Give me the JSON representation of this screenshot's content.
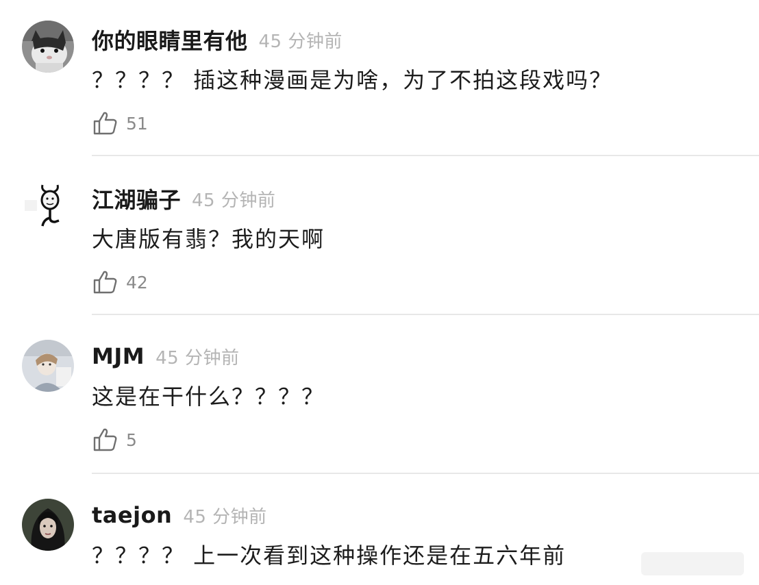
{
  "comments": [
    {
      "username": "你的眼睛里有他",
      "time": "45 分钟前",
      "text": "？？？？ 插这种漫画是为啥，为了不拍这段戏吗？",
      "likes": "51",
      "avatar_icon": "cat-avatar-icon"
    },
    {
      "username": "江湖骗子",
      "time": "45 分钟前",
      "text": "大唐版有翡？我的天啊",
      "likes": "42",
      "avatar_icon": "meme-face-avatar-icon"
    },
    {
      "username": "MJM",
      "time": "45 分钟前",
      "text": "这是在干什么？？？？",
      "likes": "5",
      "avatar_icon": "photo-avatar-icon"
    },
    {
      "username": "taejon",
      "time": "45 分钟前",
      "text": "？？？？ 上一次看到这种操作还是在五六年前",
      "likes": "",
      "avatar_icon": "dark-portrait-avatar-icon"
    }
  ],
  "colors": {
    "username": "#1a1a1a",
    "timestamp": "#b4b4b4",
    "like_count": "#8a8a8a",
    "divider": "#e7e7e7"
  }
}
